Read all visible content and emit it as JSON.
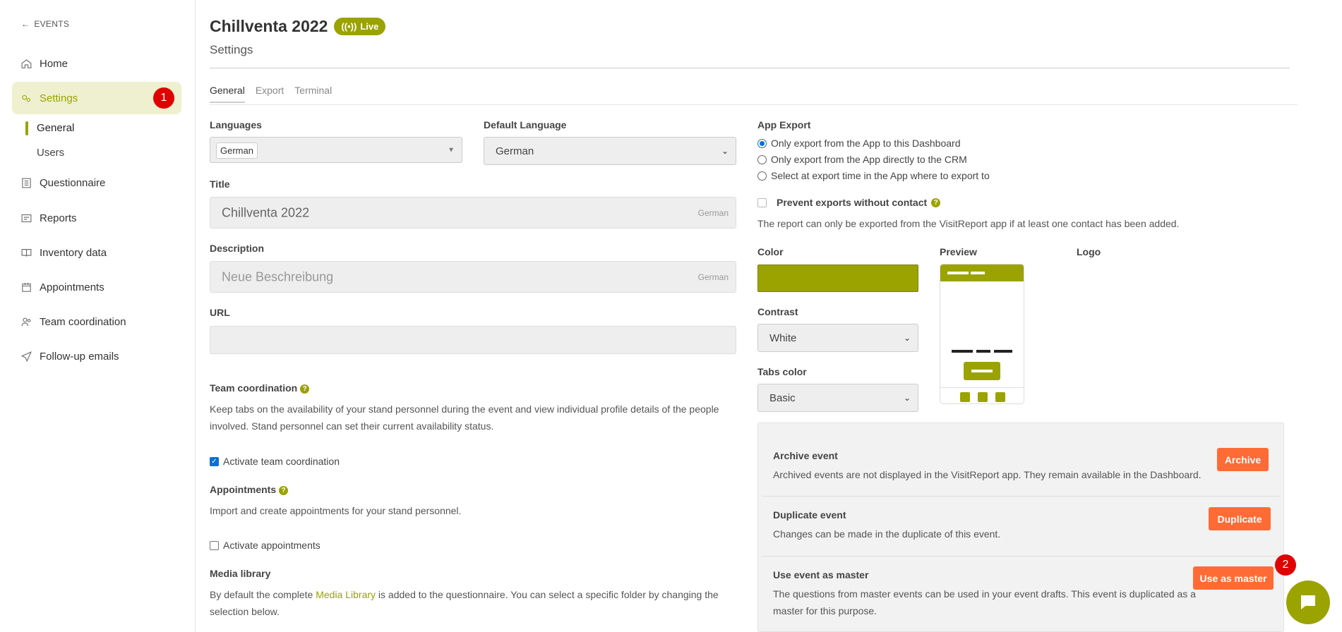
{
  "sidebar": {
    "back_label": "EVENTS",
    "items": [
      {
        "label": "Home",
        "icon": "home-icon"
      },
      {
        "label": "Settings",
        "icon": "settings-icon",
        "badge": "1"
      },
      {
        "label": "Questionnaire",
        "icon": "questionnaire-icon"
      },
      {
        "label": "Reports",
        "icon": "reports-icon"
      },
      {
        "label": "Inventory data",
        "icon": "book-icon"
      },
      {
        "label": "Appointments",
        "icon": "calendar-icon"
      },
      {
        "label": "Team coordination",
        "icon": "team-icon"
      },
      {
        "label": "Follow-up emails",
        "icon": "send-icon"
      }
    ],
    "sub_items": [
      {
        "label": "General"
      },
      {
        "label": "Users"
      }
    ]
  },
  "header": {
    "title": "Chillventa 2022",
    "live_label": "Live",
    "subtitle": "Settings"
  },
  "tabs": [
    {
      "label": "General"
    },
    {
      "label": "Export"
    },
    {
      "label": "Terminal"
    }
  ],
  "form": {
    "languages_label": "Languages",
    "languages_chip": "German",
    "default_language_label": "Default Language",
    "default_language_value": "German",
    "title_label": "Title",
    "title_value": "Chillventa 2022",
    "title_hint": "German",
    "description_label": "Description",
    "description_placeholder": "Neue Beschreibung",
    "description_hint": "German",
    "url_label": "URL",
    "url_value": "",
    "team_label": "Team coordination",
    "team_text_1": "Keep tabs on the availability of your stand personnel during the event and view individual profile details of the people",
    "team_text_2": "involved. Stand personnel can set their current availability status.",
    "team_checkbox": "Activate team coordination",
    "appointments_label": "Appointments",
    "appointments_text": "Import and create appointments for your stand personnel.",
    "appointments_checkbox": "Activate appointments",
    "media_label": "Media library",
    "media_text_pre": "By default the complete ",
    "media_link": "Media Library",
    "media_text_post": " is added to the questionnaire. You can select a specific folder by changing the",
    "media_text_2": "selection below."
  },
  "app_export": {
    "label": "App Export",
    "options": [
      {
        "label": "Only export from the App to this Dashboard",
        "selected": true
      },
      {
        "label": "Only export from the App directly to the CRM",
        "selected": false
      },
      {
        "label": "Select at export time in the App where to export to",
        "selected": false
      }
    ],
    "prevent_label": "Prevent exports without contact",
    "prevent_text": "The report can only be exported from the VisitReport app if at least one contact has been added."
  },
  "appearance": {
    "color_label": "Color",
    "color_value": "#9aa300",
    "preview_label": "Preview",
    "logo_label": "Logo",
    "contrast_label": "Contrast",
    "contrast_value": "White",
    "tabs_color_label": "Tabs color",
    "tabs_color_value": "Basic"
  },
  "actions": [
    {
      "title": "Archive event",
      "text": "Archived events are not displayed in the VisitReport app. They remain available in the Dashboard.",
      "button": "Archive"
    },
    {
      "title": "Duplicate event",
      "text": "Changes can be made in the duplicate of this event.",
      "button": "Duplicate"
    },
    {
      "title": "Use event as master",
      "text": "The questions from master events can be used in your event drafts. This event is duplicated as a",
      "text_2": "master for this purpose.",
      "button": "Use as master",
      "badge": "2"
    }
  ],
  "colors": {
    "accent": "#9aa300",
    "action_button": "#ff6b35",
    "badge": "#e00000"
  }
}
